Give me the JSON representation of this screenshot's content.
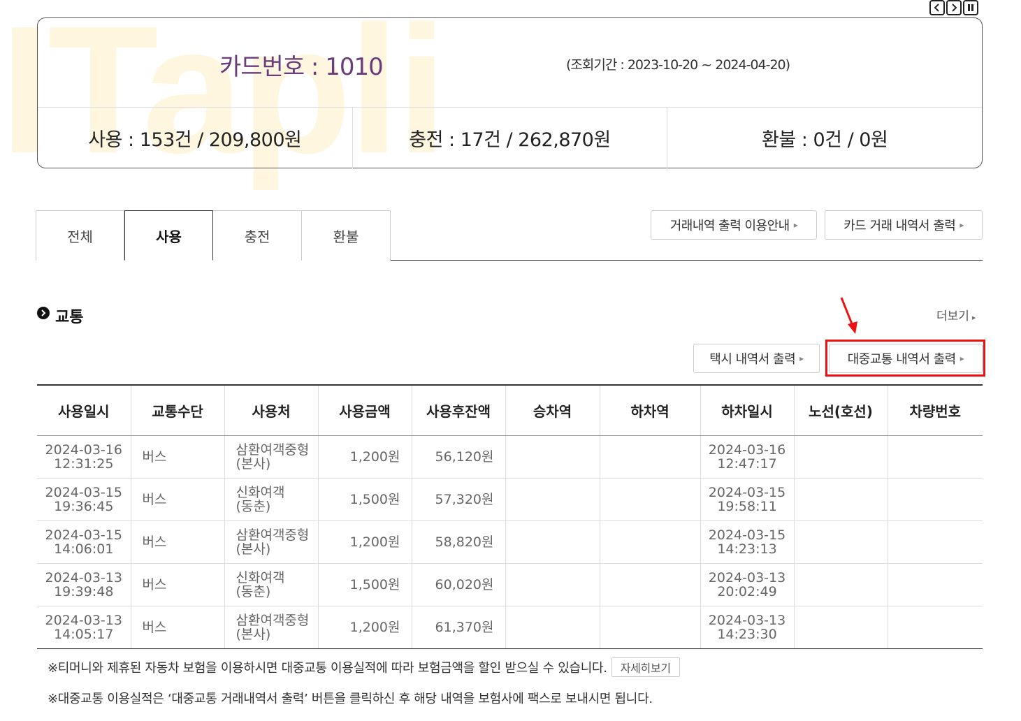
{
  "watermark": "ITapli",
  "summary": {
    "card_no": "카드번호 : 1010",
    "period": "(조회기간 : 2023-10-20 ~ 2024-04-20)",
    "usage": "사용 : 153건 / 209,800원",
    "charge": "충전 : 17건 / 262,870원",
    "refund": "환불 : 0건 / 0원"
  },
  "tabs": [
    {
      "label": "전체",
      "active": false
    },
    {
      "label": "사용",
      "active": true
    },
    {
      "label": "충전",
      "active": false
    },
    {
      "label": "환불",
      "active": false
    }
  ],
  "top_buttons": {
    "guide": "거래내역 출력 이용안내",
    "card_statement": "카드 거래 내역서 출력"
  },
  "section": {
    "title": "교통",
    "more": "더보기",
    "taxi_btn": "택시 내역서 출력",
    "public_btn": "대중교통 내역서 출력"
  },
  "table": {
    "headers": [
      "사용일시",
      "교통수단",
      "사용처",
      "사용금액",
      "사용후잔액",
      "승차역",
      "하차역",
      "하차일시",
      "노선(호선)",
      "차량번호"
    ],
    "rows": [
      {
        "use_date": "2024-03-16",
        "use_time": "12:31:25",
        "mode": "버스",
        "place1": "삼환여객중형",
        "place2": "(본사)",
        "amount": "1,200원",
        "balance": "56,120원",
        "board": "",
        "alight": "",
        "alight_date": "2024-03-16",
        "alight_time": "12:47:17",
        "route": "",
        "vehicle": ""
      },
      {
        "use_date": "2024-03-15",
        "use_time": "19:36:45",
        "mode": "버스",
        "place1": "신화여객",
        "place2": "(동춘)",
        "amount": "1,500원",
        "balance": "57,320원",
        "board": "",
        "alight": "",
        "alight_date": "2024-03-15",
        "alight_time": "19:58:11",
        "route": "",
        "vehicle": ""
      },
      {
        "use_date": "2024-03-15",
        "use_time": "14:06:01",
        "mode": "버스",
        "place1": "삼환여객중형",
        "place2": "(본사)",
        "amount": "1,200원",
        "balance": "58,820원",
        "board": "",
        "alight": "",
        "alight_date": "2024-03-15",
        "alight_time": "14:23:13",
        "route": "",
        "vehicle": ""
      },
      {
        "use_date": "2024-03-13",
        "use_time": "19:39:48",
        "mode": "버스",
        "place1": "신화여객",
        "place2": "(동춘)",
        "amount": "1,500원",
        "balance": "60,020원",
        "board": "",
        "alight": "",
        "alight_date": "2024-03-13",
        "alight_time": "20:02:49",
        "route": "",
        "vehicle": ""
      },
      {
        "use_date": "2024-03-13",
        "use_time": "14:05:17",
        "mode": "버스",
        "place1": "삼환여객중형",
        "place2": "(본사)",
        "amount": "1,200원",
        "balance": "61,370원",
        "board": "",
        "alight": "",
        "alight_date": "2024-03-13",
        "alight_time": "14:23:30",
        "route": "",
        "vehicle": ""
      }
    ]
  },
  "notes": {
    "note1": "※티머니와 제휴된 자동차 보험을 이용하시면 대중교통 이용실적에 따라 보험금액을 할인 받으실 수 있습니다.",
    "detail_btn": "자세히보기",
    "note2": "※대중교통 이용실적은 ‘대중교통 거래내역서 출력’ 버튼을 클릭하신 후 해당 내역을 보험사에 팩스로 보내시면 됩니다."
  },
  "icons": {
    "prev": "chevron-left-icon",
    "next": "chevron-right-icon",
    "pause": "pause-icon",
    "bullet": "circle-arrow-icon",
    "annotation": "red-arrow-icon"
  },
  "colors": {
    "card_no": "#6a3c7a",
    "highlight": "#ee1111",
    "watermark": "#fff3d6"
  }
}
